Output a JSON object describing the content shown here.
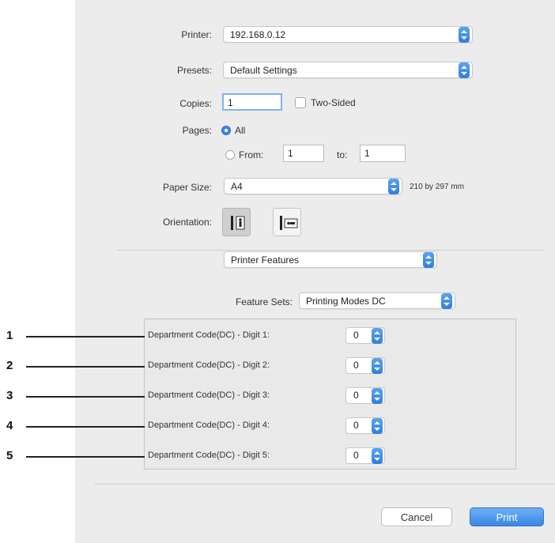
{
  "printer": {
    "label": "Printer:",
    "value": "192.168.0.12"
  },
  "presets": {
    "label": "Presets:",
    "value": "Default Settings"
  },
  "copies": {
    "label": "Copies:",
    "value": "1",
    "two_sided_label": "Two-Sided"
  },
  "pages": {
    "label": "Pages:",
    "all_label": "All",
    "from_label": "From:",
    "from_value": "1",
    "to_label": "to:",
    "to_value": "1"
  },
  "paper_size": {
    "label": "Paper Size:",
    "value": "A4",
    "dimensions": "210 by 297 mm"
  },
  "orientation": {
    "label": "Orientation:",
    "options": [
      "portrait-icon",
      "landscape-icon"
    ],
    "selected": "portrait-icon"
  },
  "section_popup": {
    "value": "Printer Features"
  },
  "feature_sets": {
    "label": "Feature Sets:",
    "value": "Printing Modes DC"
  },
  "department_codes": [
    {
      "callout": "1",
      "label": "Department Code(DC) - Digit 1:",
      "value": "0"
    },
    {
      "callout": "2",
      "label": "Department Code(DC) - Digit 2:",
      "value": "0"
    },
    {
      "callout": "3",
      "label": "Department Code(DC) - Digit 3:",
      "value": "0"
    },
    {
      "callout": "4",
      "label": "Department Code(DC) - Digit 4:",
      "value": "0"
    },
    {
      "callout": "5",
      "label": "Department Code(DC) - Digit 5:",
      "value": "0"
    }
  ],
  "buttons": {
    "cancel": "Cancel",
    "print": "Print"
  },
  "colors": {
    "accent": "#3a86e3",
    "dialog_bg": "#ececec"
  }
}
